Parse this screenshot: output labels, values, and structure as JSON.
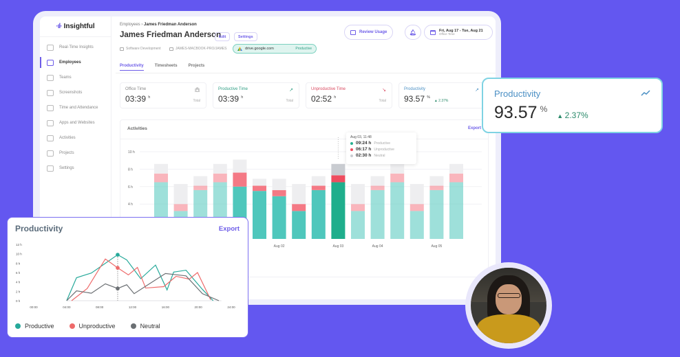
{
  "app": {
    "logo_text": "Insightful"
  },
  "sidebar": {
    "items": [
      {
        "label": "Real-Time Insights",
        "icon": "stopwatch-icon",
        "active": false
      },
      {
        "label": "Employees",
        "icon": "users-icon",
        "active": true
      },
      {
        "label": "Teams",
        "icon": "teams-icon",
        "active": false
      },
      {
        "label": "Screenshots",
        "icon": "screenshot-icon",
        "active": false
      },
      {
        "label": "Time and Attendance",
        "icon": "calendar-icon",
        "active": false
      },
      {
        "label": "Apps and Websites",
        "icon": "monitor-icon",
        "active": false
      },
      {
        "label": "Activities",
        "icon": "list-icon",
        "active": false
      },
      {
        "label": "Projects",
        "icon": "briefcase-icon",
        "active": false
      },
      {
        "label": "Settings",
        "icon": "gear-icon",
        "active": false
      }
    ]
  },
  "header": {
    "breadcrumb_parent": "Employees",
    "breadcrumb_sep": "›",
    "breadcrumb_current": "James Friedman Anderson",
    "title": "James Friedman Anderson",
    "edit_label": "Edit",
    "settings_label": "Settings",
    "department": "Software Development",
    "device": "JAMES-MACBOOK-PRO/JAMES",
    "current_app": "drive.google.com",
    "current_app_status": "Productive",
    "review_usage_label": "Review Usage",
    "date_range": "Fri, Aug 17 - Tue, Aug 21",
    "date_range_sub": "Office Time"
  },
  "tabs": [
    {
      "label": "Productivity",
      "active": true
    },
    {
      "label": "Timesheets",
      "active": false
    },
    {
      "label": "Projects",
      "active": false
    }
  ],
  "stats": [
    {
      "label": "Office Time",
      "value": "03:39",
      "unit": "h",
      "note": "Total",
      "icon": "briefcase-icon",
      "color": "#888888"
    },
    {
      "label": "Productive Time",
      "value": "03:39",
      "unit": "h",
      "note": "Total",
      "icon": "trend-up-icon",
      "color": "#2f9e84"
    },
    {
      "label": "Unproductive Time",
      "value": "02:52",
      "unit": "h",
      "note": "Total",
      "icon": "trend-down-icon",
      "color": "#d9485f"
    },
    {
      "label": "Productivity",
      "value": "93.57",
      "unit": "%",
      "note": "▲ 2.37%",
      "icon": "trend-up-icon",
      "color": "#4a8fc4"
    }
  ],
  "activities": {
    "title": "Activities",
    "export_label": "Export",
    "tooltip": {
      "title": "Aug 03, 11:48",
      "rows": [
        {
          "value": "09:24 h",
          "label": "Productive",
          "color": "#26b091"
        },
        {
          "value": "06:17 h",
          "label": "Unproductive",
          "color": "#ee4d5f"
        },
        {
          "value": "02:30 h",
          "label": "Neutral",
          "color": "#c9ccd1"
        }
      ]
    }
  },
  "productivity_popout": {
    "label": "Productivity",
    "value": "93.57",
    "unit": "%",
    "delta": "2.37%"
  },
  "productivity_card": {
    "title": "Productivity",
    "export_label": "Export"
  },
  "chart_data": [
    {
      "type": "bar",
      "title": "Activities",
      "stacked": true,
      "ylabel": "",
      "ylim": [
        0,
        10
      ],
      "yticks": [
        "4 h",
        "6 h",
        "8 h",
        "10 h"
      ],
      "ytick_values": [
        4,
        6,
        8,
        10
      ],
      "x_labels": [
        {
          "index": 6,
          "label": "Aug 02"
        },
        {
          "index": 9,
          "label": "Aug 03"
        },
        {
          "index": 11,
          "label": "Aug 04"
        },
        {
          "index": 14,
          "label": "Aug 05"
        }
      ],
      "highlight_index": 9,
      "series": [
        {
          "name": "Productive",
          "color": "#4fc7bc",
          "values": [
            6.5,
            3.2,
            5.6,
            6.5,
            6.0,
            5.5,
            4.9,
            3.2,
            5.6,
            6.5,
            3.2,
            5.6,
            6.5,
            3.2,
            5.6,
            6.5
          ]
        },
        {
          "name": "Unproductive",
          "color": "#f47985",
          "values": [
            1.0,
            0.8,
            0.5,
            1.0,
            1.6,
            0.6,
            0.7,
            0.8,
            0.5,
            0.8,
            0.8,
            0.5,
            1.0,
            0.8,
            0.5,
            1.0
          ]
        },
        {
          "name": "Neutral",
          "color": "#eeeef0",
          "values": [
            1.1,
            2.3,
            1.1,
            1.1,
            1.5,
            0.8,
            1.3,
            2.3,
            1.1,
            1.3,
            2.3,
            1.1,
            1.1,
            2.3,
            1.1,
            1.1
          ]
        }
      ],
      "faded_indices": [
        0,
        1,
        2,
        3,
        10,
        11,
        12,
        13,
        14,
        15
      ]
    },
    {
      "type": "line",
      "title": "Productivity",
      "xlim": [
        0,
        24
      ],
      "ylim": [
        0,
        12
      ],
      "xticks": [
        "00:00",
        "04:00",
        "08:00",
        "12:00",
        "16:00",
        "20:00",
        "24:00"
      ],
      "xtick_values": [
        0,
        4,
        8,
        12,
        16,
        20,
        24
      ],
      "yticks": [
        "0 h",
        "2 h",
        "4 h",
        "6 h",
        "8 h",
        "10 h",
        "12 h"
      ],
      "ytick_values": [
        0,
        2,
        4,
        6,
        8,
        10,
        12
      ],
      "marker_x": 10.2,
      "legend": "bottom",
      "series": [
        {
          "name": "Productive",
          "color": "#26a99a",
          "points": [
            [
              4,
              0
            ],
            [
              5.2,
              4.9
            ],
            [
              7,
              5.9
            ],
            [
              10.2,
              9.8
            ],
            [
              11.3,
              8.7
            ],
            [
              13,
              4.7
            ],
            [
              14.8,
              7.6
            ],
            [
              16.2,
              2.3
            ],
            [
              17,
              6.1
            ],
            [
              18.5,
              6.5
            ],
            [
              20.5,
              2.4
            ],
            [
              21.8,
              0
            ]
          ]
        },
        {
          "name": "Unproductive",
          "color": "#ee6a6a",
          "points": [
            [
              4.6,
              0
            ],
            [
              6.5,
              2.6
            ],
            [
              7.3,
              4.9
            ],
            [
              8.7,
              8.9
            ],
            [
              10.2,
              7.0
            ],
            [
              11.5,
              5.5
            ],
            [
              12.6,
              7.1
            ],
            [
              13.6,
              2.7
            ],
            [
              15.8,
              3.0
            ],
            [
              17.3,
              5.2
            ],
            [
              18.9,
              4.6
            ],
            [
              19.9,
              6.0
            ],
            [
              21.5,
              0.2
            ]
          ]
        },
        {
          "name": "Neutral",
          "color": "#6b6f73",
          "points": [
            [
              4,
              0
            ],
            [
              5.2,
              2.1
            ],
            [
              7,
              1.6
            ],
            [
              8.7,
              3.6
            ],
            [
              10.2,
              2.6
            ],
            [
              11.3,
              3.4
            ],
            [
              12.2,
              1.5
            ],
            [
              16,
              5.8
            ],
            [
              18.5,
              5.3
            ],
            [
              20.5,
              1.5
            ],
            [
              22.5,
              0
            ]
          ]
        }
      ],
      "markers": [
        {
          "series": "Productive",
          "x": 10.2,
          "y": 9.8
        },
        {
          "series": "Unproductive",
          "x": 10.2,
          "y": 7.0
        },
        {
          "series": "Neutral",
          "x": 10.2,
          "y": 2.6
        }
      ]
    }
  ]
}
